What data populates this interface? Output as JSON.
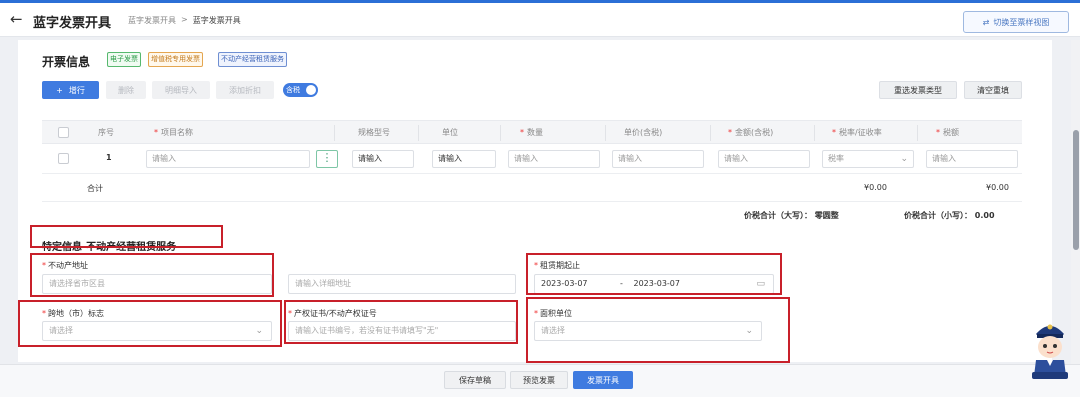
{
  "header": {
    "title": "蓝字发票开具",
    "breadcrumb": [
      "蓝字发票开具",
      ">",
      "蓝字发票开具"
    ],
    "switch_label": "切换至票样视图"
  },
  "invoice_info": {
    "title": "开票信息",
    "tags": [
      "电子发票",
      "增值税专用发票",
      "不动产经营租赁服务"
    ]
  },
  "toolbar": {
    "add": "增行",
    "delete": "删除",
    "import": "明细导入",
    "discount": "添加折扣",
    "tax_toggle": "含税",
    "reselect": "重选发票类型",
    "clear": "清空重填"
  },
  "table": {
    "headers": [
      "序号",
      "项目名称",
      "规格型号",
      "单位",
      "数量",
      "单价(含税)",
      "金额(含税)",
      "税率/征收率",
      "税额"
    ],
    "row": {
      "seq": "1",
      "item_placeholder": "请输入",
      "spec": "请输入",
      "unit": "请输入",
      "qty_placeholder": "请输入",
      "price_placeholder": "请输入",
      "amount_placeholder": "请输入",
      "rate_placeholder": "税率",
      "tax_placeholder": "请输入"
    },
    "sum_label": "合计",
    "sum_amount": "¥0.00",
    "sum_tax": "¥0.00",
    "total_upper": "价税合计（大写）：  零圆整",
    "total_lower": "价税合计（小写）：  0.00"
  },
  "special": {
    "title": "特定信息-不动产经营租赁服务",
    "address_label": "不动产地址",
    "address_placeholder": "请选择省市区县",
    "address_detail_placeholder": "请输入详细地址",
    "lease_label": "租赁期起止",
    "lease_start": "2023-03-07",
    "lease_sep": "-",
    "lease_end": "2023-03-07",
    "cross_label": "跨地（市）标志",
    "cross_placeholder": "请选择",
    "cert_label": "产权证书/不动产权证号",
    "cert_placeholder": "请输入证书编号，若没有证书请填写\"无\"",
    "area_label": "面积单位",
    "area_placeholder": "请选择"
  },
  "footer": {
    "save_draft": "保存草稿",
    "preview": "预览发票",
    "issue": "发票开具"
  },
  "colors": {
    "primary": "#3f7be0",
    "highlight_box": "#c8202a"
  }
}
